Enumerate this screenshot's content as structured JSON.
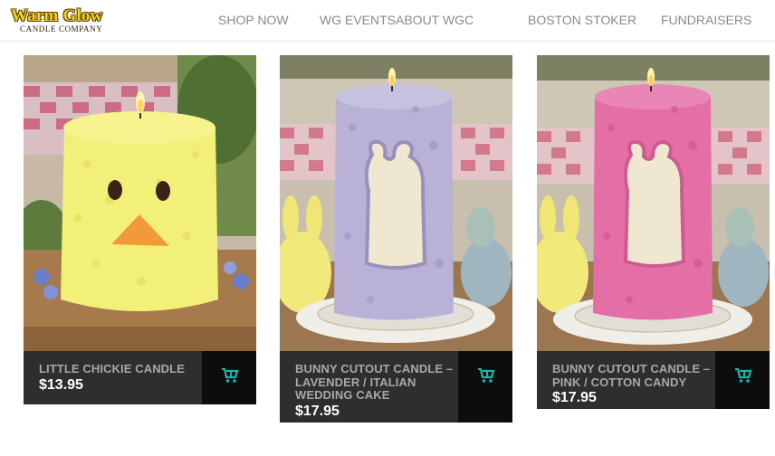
{
  "brand": {
    "logo_line1": "Warm Glow",
    "logo_line2": "CANDLE COMPANY"
  },
  "nav": {
    "items": [
      {
        "label": "SHOP NOW"
      },
      {
        "label": "WG EVENTS"
      },
      {
        "label": "ABOUT WGC"
      },
      {
        "label": "BOSTON STOKER"
      },
      {
        "label": "FUNDRAISERS"
      }
    ]
  },
  "products": [
    {
      "name": "LITTLE CHICKIE CANDLE",
      "price": "$13.95",
      "cart_icon": "cart-icon"
    },
    {
      "name": "BUNNY CUTOUT CANDLE – LAVENDER / ITALIAN WEDDING CAKE",
      "price": "$17.95",
      "cart_icon": "cart-icon"
    },
    {
      "name": "BUNNY CUTOUT CANDLE – PINK / COTTON CANDY",
      "price": "$17.95",
      "cart_icon": "cart-icon"
    }
  ],
  "colors": {
    "accent": "#19b7a8",
    "info_bar": "#2e2e2e",
    "cart_bg": "#0d0d0d",
    "chick_candle": "#f3f07a",
    "lavender_candle": "#b9b2d6",
    "pink_candle": "#e46fa6"
  }
}
